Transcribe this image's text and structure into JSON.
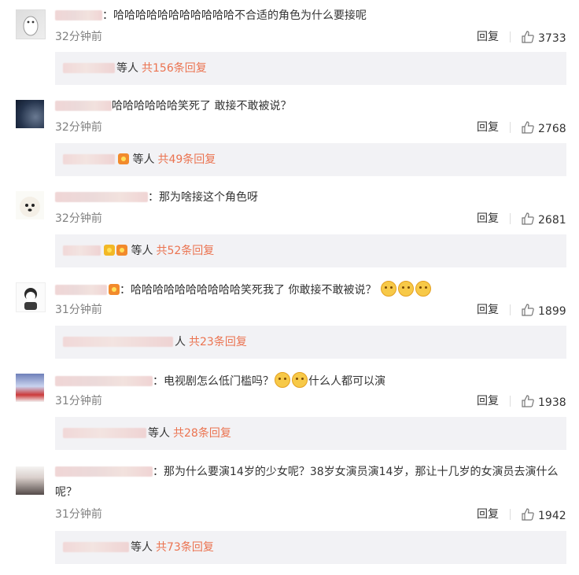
{
  "ui": {
    "reply_label": "回复",
    "deng_ren": "等人",
    "colon": "："
  },
  "comments": [
    {
      "text": "哈哈哈哈哈哈哈哈哈哈哈不合适的角色为什么要接呢",
      "time": "32分钟前",
      "likes": "3733",
      "replies_link": "共156条回复",
      "emojis": 0
    },
    {
      "text": "哈哈哈哈哈哈笑死了 敢接不敢被说？",
      "time": "32分钟前",
      "likes": "2768",
      "replies_link": "共49条回复",
      "emojis": 0
    },
    {
      "text": "那为啥接这个角色呀",
      "time": "32分钟前",
      "likes": "2681",
      "replies_link": "共52条回复",
      "emojis": 0
    },
    {
      "text": "哈哈哈哈哈哈哈哈哈哈笑死我了 你敢接不敢被说？",
      "time": "31分钟前",
      "likes": "1899",
      "replies_link": "共23条回复",
      "emojis": 3
    },
    {
      "text_a": "电视剧怎么低门槛吗？",
      "text_b": "什么人都可以演",
      "time": "31分钟前",
      "likes": "1938",
      "replies_link": "共28条回复",
      "emojis": 2
    },
    {
      "text": "那为什么要演14岁的少女呢？38岁女演员演14岁，那让十几岁的女演员去演什么呢？",
      "time": "31分钟前",
      "likes": "1942",
      "replies_link": "共73条回复",
      "emojis": 0
    }
  ],
  "icons": {
    "like": "thumbs-up-icon",
    "emoji": "doge-emoji-icon",
    "badge": "vip-badge-icon"
  }
}
